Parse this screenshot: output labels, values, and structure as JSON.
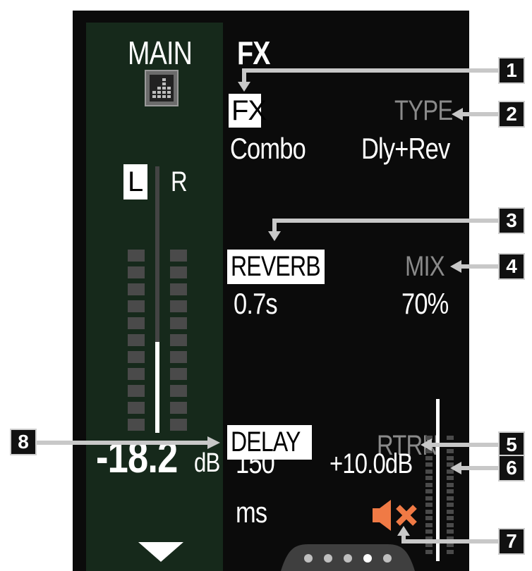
{
  "left_panel": {
    "title": "MAIN",
    "icon": "bar-chart-icon",
    "left_channel": "L",
    "right_channel": "R",
    "level_value": "-18.2",
    "level_unit": "dB",
    "meter_fill_fraction": 0.34
  },
  "fx_panel": {
    "title": "FX",
    "fx_label": "FX",
    "fx_value": "Combo",
    "type_label": "TYPE",
    "type_value": "Dly+Rev",
    "reverb_label": "REVERB",
    "reverb_value": "0.7s",
    "mix_label": "MIX",
    "mix_value": "70%",
    "delay_label": "DELAY",
    "delay_value": "150",
    "delay_unit": "ms",
    "return_label": "RTRN",
    "return_value": "+10.0dB",
    "mute_icon": "speaker-muted-icon"
  },
  "page_indicator": {
    "total_pages": 5,
    "active_page": 4
  },
  "callouts": [
    "1",
    "2",
    "3",
    "4",
    "5",
    "6",
    "7",
    "8"
  ],
  "colors": {
    "background": "#0b0b0b",
    "main_panel": "#16291b",
    "muted_accent": "#f07a45",
    "label_grey": "#8a8a8a",
    "callout_line": "#c8c8c8"
  }
}
